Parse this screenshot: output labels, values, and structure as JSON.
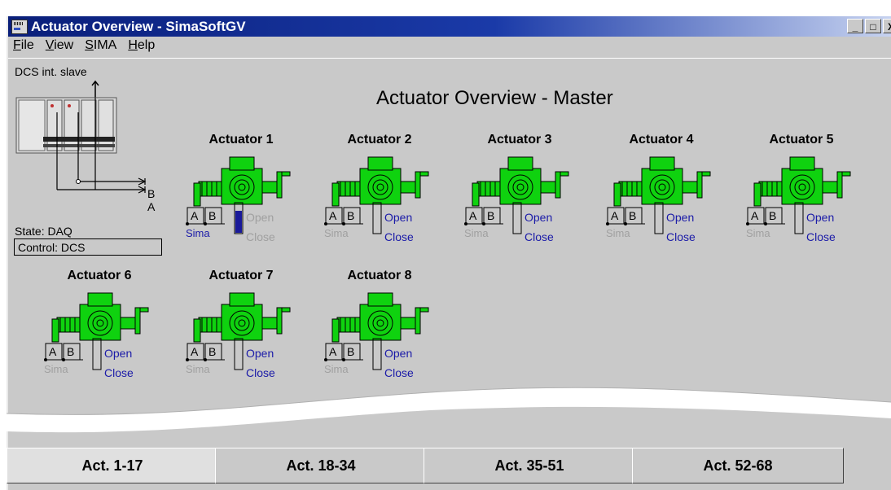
{
  "window": {
    "title": "Actuator Overview - SimaSoftGV",
    "controls": [
      "_",
      "□",
      "X"
    ]
  },
  "menu": [
    {
      "label": "File",
      "accel": "F"
    },
    {
      "label": "View",
      "accel": "V"
    },
    {
      "label": "SIMA",
      "accel": "S"
    },
    {
      "label": "Help",
      "accel": "H"
    }
  ],
  "panel": {
    "dcs_label": "DCS int. slave",
    "bus_a": "A",
    "bus_b": "B",
    "state": "State: DAQ",
    "control": "Control: DCS"
  },
  "main_title": "Actuator Overview - Master",
  "actuators": [
    {
      "name": "Actuator 1",
      "open": "Open",
      "close": "Close",
      "sima": "Sima",
      "a": "A",
      "b": "B",
      "open_active": false,
      "close_active": false,
      "sima_active": true,
      "level": 0.75
    },
    {
      "name": "Actuator 2",
      "open": "Open",
      "close": "Close",
      "sima": "Sima",
      "a": "A",
      "b": "B",
      "open_active": true,
      "close_active": true,
      "sima_active": false,
      "level": 0
    },
    {
      "name": "Actuator 3",
      "open": "Open",
      "close": "Close",
      "sima": "Sima",
      "a": "A",
      "b": "B",
      "open_active": true,
      "close_active": true,
      "sima_active": false,
      "level": 0
    },
    {
      "name": "Actuator 4",
      "open": "Open",
      "close": "Close",
      "sima": "Sima",
      "a": "A",
      "b": "B",
      "open_active": true,
      "close_active": true,
      "sima_active": false,
      "level": 0
    },
    {
      "name": "Actuator 5",
      "open": "Open",
      "close": "Close",
      "sima": "Sima",
      "a": "A",
      "b": "B",
      "open_active": true,
      "close_active": true,
      "sima_active": false,
      "level": 0
    },
    {
      "name": "Actuator 6",
      "open": "Open",
      "close": "Close",
      "sima": "Sima",
      "a": "A",
      "b": "B",
      "open_active": true,
      "close_active": true,
      "sima_active": false,
      "level": 0
    },
    {
      "name": "Actuator 7",
      "open": "Open",
      "close": "Close",
      "sima": "Sima",
      "a": "A",
      "b": "B",
      "open_active": true,
      "close_active": true,
      "sima_active": false,
      "level": 0
    },
    {
      "name": "Actuator 8",
      "open": "Open",
      "close": "Close",
      "sima": "Sima",
      "a": "A",
      "b": "B",
      "open_active": true,
      "close_active": true,
      "sima_active": false,
      "level": 0
    }
  ],
  "tabs": [
    {
      "label": "Act. 1-17",
      "active": true
    },
    {
      "label": "Act. 18-34",
      "active": false
    },
    {
      "label": "Act. 35-51",
      "active": false
    },
    {
      "label": "Act. 52-68",
      "active": false
    }
  ],
  "colors": {
    "actuator_green": "#0fd20f",
    "active_text": "#1a1aa8",
    "inactive_text": "#a0a0a0",
    "level_fill": "#1a1a9a"
  }
}
